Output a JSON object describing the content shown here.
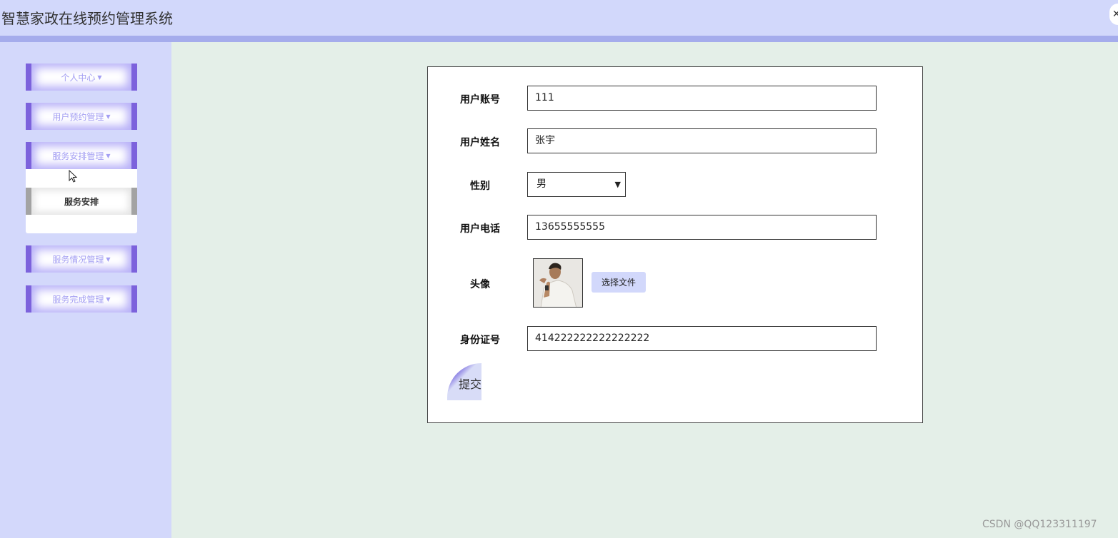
{
  "header": {
    "title": "智慧家政在线预约管理系统",
    "close_icon": "close-icon"
  },
  "sidebar": {
    "menus": [
      {
        "label": "个人中心"
      },
      {
        "label": "用户预约管理"
      },
      {
        "label": "服务安排管理",
        "expanded": true,
        "children": [
          {
            "label": "服务安排"
          }
        ]
      },
      {
        "label": "服务情况管理"
      },
      {
        "label": "服务完成管理"
      }
    ]
  },
  "form": {
    "account_label": "用户账号",
    "account_value": "111",
    "name_label": "用户姓名",
    "name_value": "张宇",
    "gender_label": "性别",
    "gender_value": "男",
    "phone_label": "用户电话",
    "phone_value": "13655555555",
    "avatar_label": "头像",
    "file_button": "选择文件",
    "idcard_label": "身份证号",
    "idcard_value": "414222222222222222",
    "submit_label": "提交"
  },
  "watermark": "CSDN @QQ123311197",
  "colors": {
    "header_bg": "#d2d8fb",
    "accent_purple": "#7c62dc",
    "content_bg": "#e4efe8"
  }
}
